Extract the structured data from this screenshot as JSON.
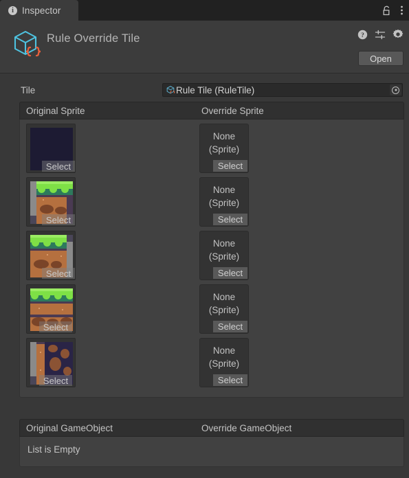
{
  "window": {
    "background": "#383838",
    "tab": {
      "label": "Inspector",
      "icon": "info-icon"
    },
    "tabbar_icons": [
      {
        "name": "lock-icon",
        "label": "Lock"
      },
      {
        "name": "kebab-menu-icon",
        "label": "More"
      }
    ]
  },
  "object_header": {
    "title": "Rule Override Tile",
    "icon": "script-cube-icon",
    "tools": [
      {
        "name": "help-icon",
        "label": "Help"
      },
      {
        "name": "preset-icon",
        "label": "Preset"
      },
      {
        "name": "gear-icon",
        "label": "Settings"
      }
    ],
    "open_button": "Open"
  },
  "tile_field": {
    "label": "Tile",
    "value": "Rule Tile (RuleTile)",
    "icon": "rule-tile-asset-icon",
    "picker_icon": "object-picker-icon"
  },
  "sprite_list": {
    "columns": {
      "original": "Original Sprite",
      "override": "Override Sprite"
    },
    "select_label": "Select",
    "none_label_line1": "None",
    "none_label_line2": "(Sprite)",
    "rows": [
      {
        "original_sprite": "empty-dark-tile",
        "override_sprite": "None (Sprite)"
      },
      {
        "original_sprite": "grass-top-left",
        "override_sprite": "None (Sprite)"
      },
      {
        "original_sprite": "grass-top-right",
        "override_sprite": "None (Sprite)"
      },
      {
        "original_sprite": "grass-top-middle",
        "override_sprite": "None (Sprite)"
      },
      {
        "original_sprite": "dirt-column-left",
        "override_sprite": "None (Sprite)"
      }
    ]
  },
  "gameobject_list": {
    "columns": {
      "original": "Original GameObject",
      "override": "Override GameObject"
    },
    "empty_message": "List is Empty"
  },
  "colors": {
    "panel": "#383838",
    "tabbar": "#212121",
    "tab_active": "#3c3c3c",
    "list_header": "#303030",
    "list_body": "#414141",
    "field": "#2a2a2a",
    "button": "#585858",
    "text": "#c4c4c4",
    "icon_blue": "#4ec3e0",
    "icon_orange": "#e8603c",
    "grass_light": "#7ee046",
    "grass_dark": "#2d7a5c",
    "dirt": "#b5703f",
    "dirt_dark": "#7a4428",
    "bg_dark": "#1d1b33"
  }
}
